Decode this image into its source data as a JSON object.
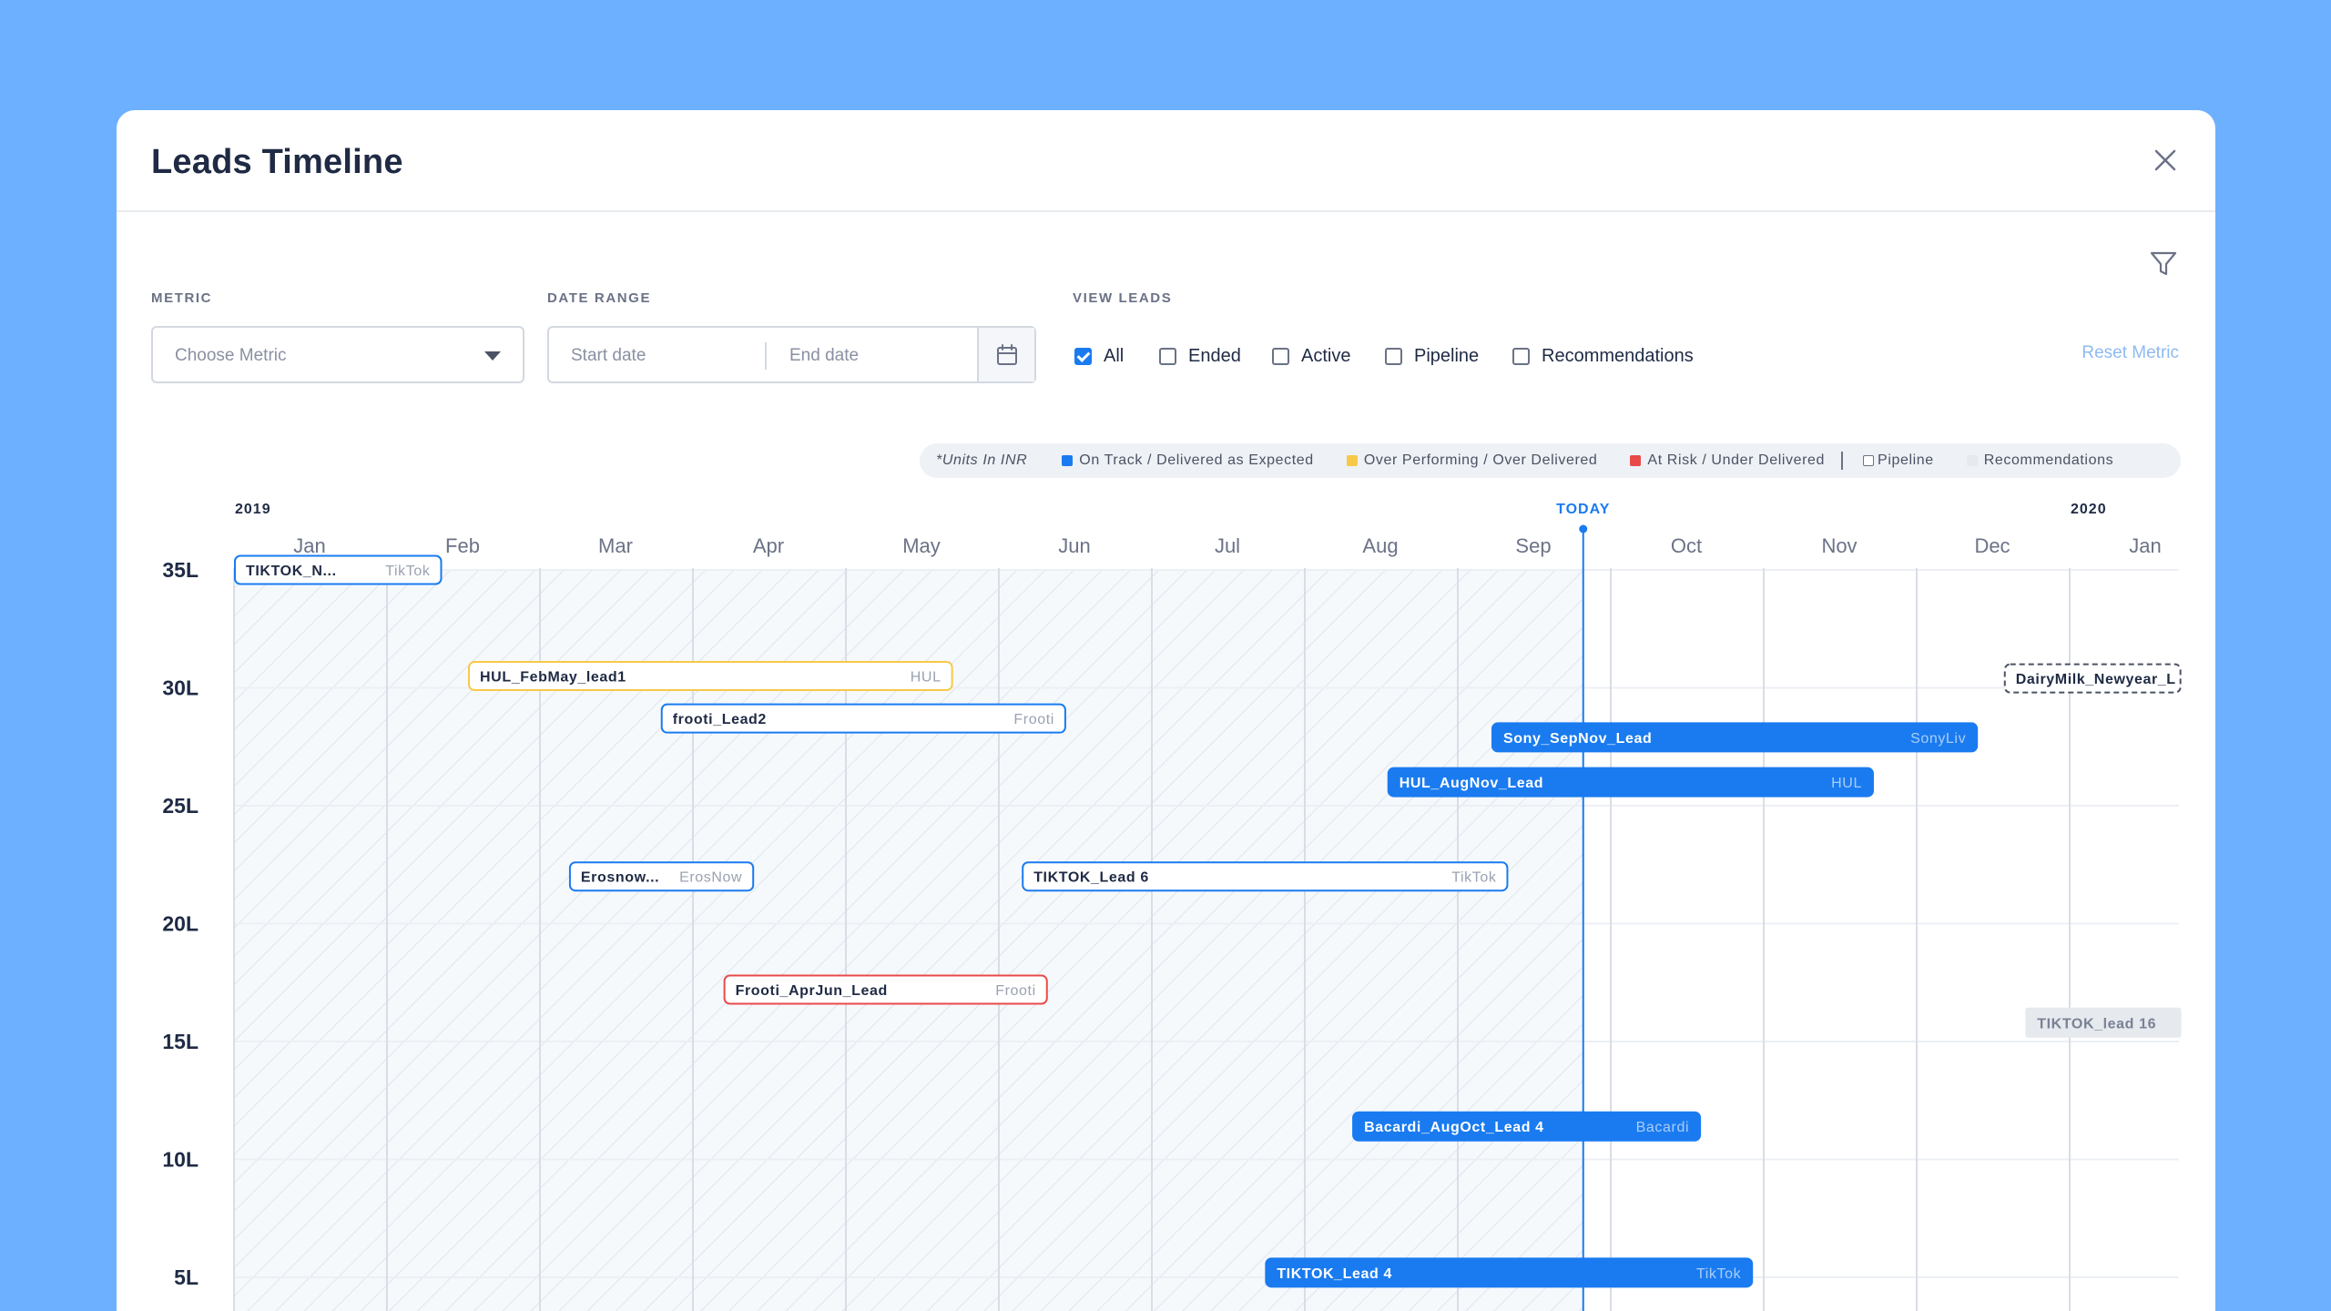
{
  "modal": {
    "title": "Leads Timeline"
  },
  "filters": {
    "metric_label": "METRIC",
    "metric_placeholder": "Choose Metric",
    "date_range_label": "DATE RANGE",
    "start_placeholder": "Start date",
    "end_placeholder": "End date",
    "view_leads_label": "VIEW LEADS",
    "view_leads": [
      {
        "label": "All",
        "checked": true
      },
      {
        "label": "Ended",
        "checked": false
      },
      {
        "label": "Active",
        "checked": false
      },
      {
        "label": "Pipeline",
        "checked": false
      },
      {
        "label": "Recommendations",
        "checked": false
      }
    ],
    "reset_label": "Reset Metric"
  },
  "legend": {
    "units": "*Units In INR",
    "items": [
      {
        "label": "On Track / Delivered as Expected",
        "color": "#1a7bf0"
      },
      {
        "label": "Over Performing / Over Delivered",
        "color": "#f7c948"
      },
      {
        "label": "At Risk / Under Delivered",
        "color": "#e84a4a"
      }
    ],
    "pipeline": "Pipeline",
    "recommendations": "Recommendations"
  },
  "colors": {
    "ontrack": "#1a7bf0",
    "over": "#f7c948",
    "risk": "#e84a4a",
    "recommendation": "#e6e9ee",
    "today": "#1a7bf0"
  },
  "chart_data": {
    "type": "timeline",
    "years": [
      {
        "label": "2019",
        "month_index": 0
      },
      {
        "label": "2020",
        "month_index": 12
      }
    ],
    "months": [
      "Jan",
      "Feb",
      "Mar",
      "Apr",
      "May",
      "Jun",
      "Jul",
      "Aug",
      "Sep",
      "Oct",
      "Nov",
      "Dec",
      "Jan"
    ],
    "today_label": "TODAY",
    "today_month": 8.82,
    "y_ticks": [
      "35L",
      "30L",
      "25L",
      "20L",
      "15L",
      "10L",
      "5L"
    ],
    "y_values": [
      35,
      30,
      25,
      20,
      15,
      10,
      5
    ],
    "ylim": [
      0,
      35
    ],
    "leads": [
      {
        "name": "TIKTOK_N...",
        "brand": "TikTok",
        "status": "ontrack-outline",
        "start": 0.0,
        "end": 1.36,
        "value": 35
      },
      {
        "name": "HUL_FebMay_lead1",
        "brand": "HUL",
        "status": "over",
        "start": 1.53,
        "end": 4.7,
        "value": 30.5
      },
      {
        "name": "frooti_Lead2",
        "brand": "Frooti",
        "status": "ontrack-outline",
        "start": 2.79,
        "end": 5.44,
        "value": 28.7
      },
      {
        "name": "Sony_SepNov_Lead",
        "brand": "SonyLiv",
        "status": "ontrack",
        "start": 8.22,
        "end": 11.4,
        "value": 27.9
      },
      {
        "name": "HUL_AugNov_Lead",
        "brand": "HUL",
        "status": "ontrack",
        "start": 7.54,
        "end": 10.72,
        "value": 26.0
      },
      {
        "name": "Erosnow...",
        "brand": "ErosNow",
        "status": "ontrack-outline",
        "start": 2.19,
        "end": 3.4,
        "value": 22.0
      },
      {
        "name": "TIKTOK_Lead 6",
        "brand": "TikTok",
        "status": "ontrack-outline",
        "start": 5.15,
        "end": 8.33,
        "value": 22.0
      },
      {
        "name": "Frooti_AprJun_Lead",
        "brand": "Frooti",
        "status": "risk",
        "start": 3.2,
        "end": 5.32,
        "value": 17.2
      },
      {
        "name": "Bacardi_AugOct_Lead 4",
        "brand": "Bacardi",
        "status": "ontrack",
        "start": 7.31,
        "end": 9.59,
        "value": 11.4
      },
      {
        "name": "TIKTOK_Lead 4",
        "brand": "TikTok",
        "status": "ontrack",
        "start": 6.74,
        "end": 9.93,
        "value": 5.2
      },
      {
        "name": "DairyMilk_Newyear_L",
        "brand": "",
        "status": "pipeline",
        "start": 11.57,
        "end": 12.73,
        "value": 30.4
      },
      {
        "name": "TIKTOK_lead 16",
        "brand": "",
        "status": "recommendation",
        "start": 11.71,
        "end": 12.73,
        "value": 15.8
      }
    ]
  }
}
